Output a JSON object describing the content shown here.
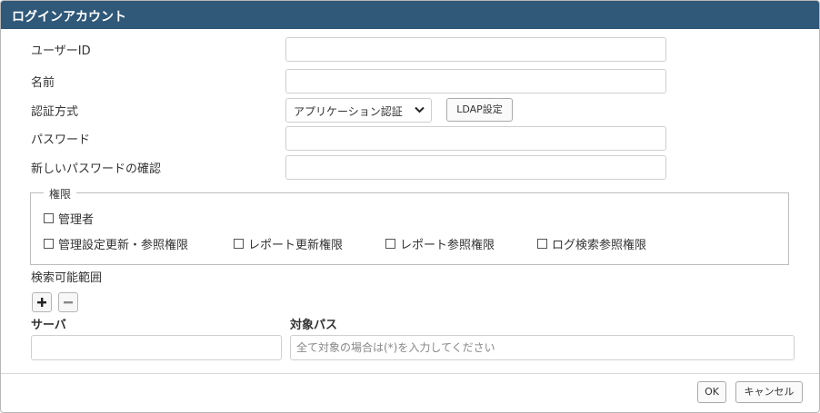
{
  "dialog": {
    "title": "ログインアカウント"
  },
  "form": {
    "user_id_label": "ユーザーID",
    "name_label": "名前",
    "auth_method_label": "認証方式",
    "auth_method_value": "アプリケーション認証",
    "ldap_button": "LDAP設定",
    "password_label": "パスワード",
    "password_confirm_label": "新しいパスワードの確認"
  },
  "permissions": {
    "legend": "権限",
    "items": [
      {
        "label": "管理者",
        "checked": false
      },
      {
        "label": "管理設定更新・参照権限",
        "checked": false
      },
      {
        "label": "レポート更新権限",
        "checked": false
      },
      {
        "label": "レポート参照権限",
        "checked": false
      },
      {
        "label": "ログ検索参照権限",
        "checked": false
      }
    ]
  },
  "search_scope": {
    "label": "検索可能範囲",
    "add_icon": "plus-icon",
    "remove_icon": "minus-icon",
    "server_header": "サーバ",
    "path_header": "対象パス",
    "path_placeholder": "全て対象の場合は(*)を入力してください"
  },
  "footer": {
    "ok": "OK",
    "cancel": "キャンセル"
  }
}
